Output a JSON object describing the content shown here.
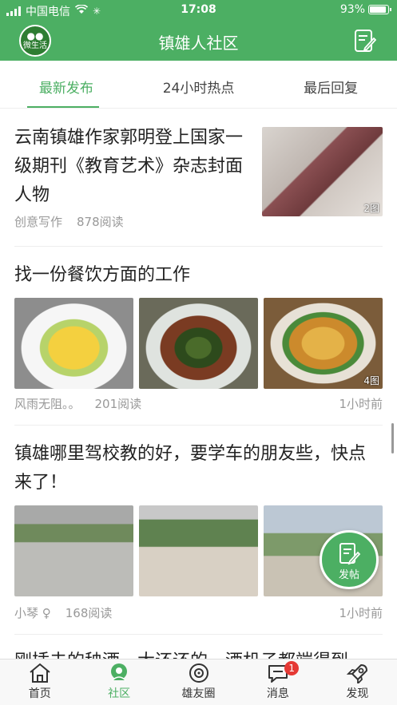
{
  "status_bar": {
    "carrier": "中国电信",
    "time": "17:08",
    "battery": "93%",
    "battery_level": 0.93
  },
  "header": {
    "logo_text": "微生活",
    "title": "镇雄人社区"
  },
  "tabs": [
    {
      "label": "最新发布",
      "active": true
    },
    {
      "label": "24小时热点",
      "active": false
    },
    {
      "label": "最后回复",
      "active": false
    }
  ],
  "posts": [
    {
      "title": "云南镇雄作家郭明登上国家一级期刊《教育艺术》杂志封面人物",
      "author": "创意写作",
      "views": "878阅读",
      "image_count": "2图"
    },
    {
      "title": "找一份餐饮方面的工作",
      "author": "风雨无阻。。",
      "views": "201阅读",
      "time": "1小时前",
      "image_count": "4图"
    },
    {
      "title": "镇雄哪里驾校教的好，要学车的朋友些，快点来了！",
      "author": "小琴 ♀",
      "views": "168阅读",
      "time": "1小时前"
    },
    {
      "title": "刚插去的秧酒，大还还的，酒机子都端得到"
    }
  ],
  "fab": {
    "label": "发帖"
  },
  "bottom_nav": [
    {
      "label": "首页",
      "icon": "home-icon",
      "active": false
    },
    {
      "label": "社区",
      "icon": "community-icon",
      "active": true
    },
    {
      "label": "雄友圈",
      "icon": "camera-circle-icon",
      "active": false
    },
    {
      "label": "消息",
      "icon": "message-icon",
      "active": false,
      "badge": "1"
    },
    {
      "label": "发现",
      "icon": "rocket-icon",
      "active": false
    }
  ],
  "colors": {
    "brand_green": "#4caf63",
    "badge_red": "#e53935"
  }
}
